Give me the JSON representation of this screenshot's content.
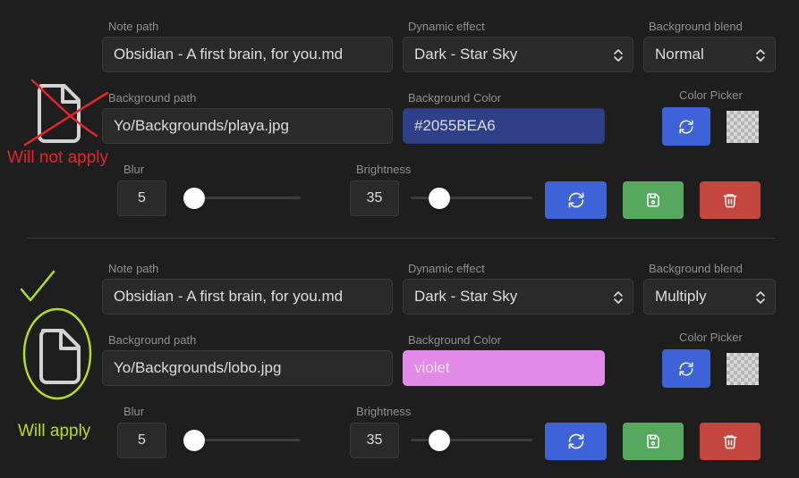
{
  "labels": {
    "note_path": "Note path",
    "dynamic_effect": "Dynamic effect",
    "background_blend": "Background blend",
    "background_path": "Background path",
    "background_color": "Background Color",
    "color_picker": "Color Picker",
    "blur": "Blur",
    "brightness": "Brightness"
  },
  "annotations": {
    "not_apply": "Will not apply",
    "apply": "Will apply",
    "not_apply_color": "#e0262b",
    "apply_color": "#b6dc1e"
  },
  "rows": [
    {
      "note_path": "Obsidian - A first brain, for you.md",
      "dynamic_effect": "Dark - Star Sky",
      "background_blend": "Normal",
      "background_path": "Yo/Backgrounds/playa.jpg",
      "background_color": "#2055BEA6",
      "background_color_swatch": "#2f3f88",
      "background_color_text": "#dcddde",
      "blur": "5",
      "blur_level": 0.0,
      "brightness": "35",
      "brightness_level": 0.18
    },
    {
      "note_path": "Obsidian - A first brain, for you.md",
      "dynamic_effect": "Dark - Star Sky",
      "background_blend": "Multiply",
      "background_path": "Yo/Backgrounds/lobo.jpg",
      "background_color": "violet",
      "background_color_swatch": "#e28ae8",
      "background_color_text": "#f4dcf6",
      "blur": "5",
      "blur_level": 0.0,
      "brightness": "35",
      "brightness_level": 0.18
    }
  ],
  "colors": {
    "accent_blue": "#3e63d8",
    "save_green": "#55a85d",
    "delete_red": "#c5463f"
  },
  "icons": {
    "file": "file-icon",
    "reset": "refresh-icon",
    "save": "save-icon",
    "delete": "trash-icon",
    "chevron": "chevron-updown-icon",
    "check": "checkmark-icon"
  }
}
